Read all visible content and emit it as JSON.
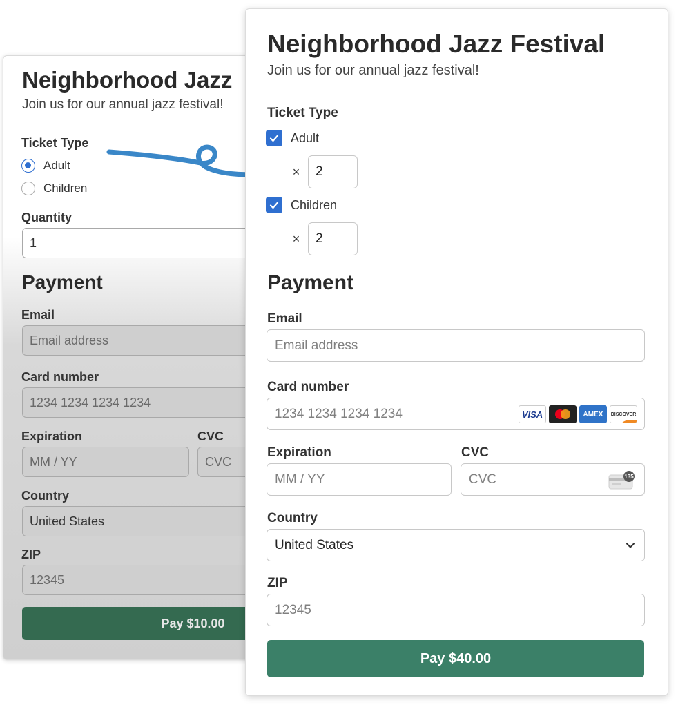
{
  "old_form": {
    "title": "Neighborhood Jazz",
    "subtitle": "Join us for our annual jazz festival!",
    "ticket_type_label": "Ticket Type",
    "ticket_options": [
      {
        "label": "Adult",
        "selected": true
      },
      {
        "label": "Children",
        "selected": false
      }
    ],
    "quantity_label": "Quantity",
    "quantity_value": "1",
    "payment_heading": "Payment",
    "email_label": "Email",
    "email_placeholder": "Email address",
    "card_label": "Card number",
    "card_placeholder": "1234 1234 1234 1234",
    "expiration_label": "Expiration",
    "expiration_placeholder": "MM / YY",
    "cvc_label": "CVC",
    "cvc_placeholder": "CVC",
    "country_label": "Country",
    "country_value": "United States",
    "zip_label": "ZIP",
    "zip_placeholder": "12345",
    "pay_label": "Pay $10.00"
  },
  "new_form": {
    "title": "Neighborhood Jazz Festival",
    "subtitle": "Join us for our annual jazz festival!",
    "ticket_type_label": "Ticket Type",
    "tickets": [
      {
        "label": "Adult",
        "checked": true,
        "times": "×",
        "quantity": "2"
      },
      {
        "label": "Children",
        "checked": true,
        "times": "×",
        "quantity": "2"
      }
    ],
    "payment_heading": "Payment",
    "email_label": "Email",
    "email_placeholder": "Email address",
    "card_label": "Card number",
    "card_placeholder": "1234 1234 1234 1234",
    "card_brands": [
      "VISA",
      "mastercard",
      "AMEX",
      "DISCOVER"
    ],
    "expiration_label": "Expiration",
    "expiration_placeholder": "MM / YY",
    "cvc_label": "CVC",
    "cvc_placeholder": "CVC",
    "cvc_icon_text": "135",
    "country_label": "Country",
    "country_value": "United States",
    "zip_label": "ZIP",
    "zip_placeholder": "12345",
    "pay_label": "Pay $40.00"
  },
  "colors": {
    "accent_blue": "#2f6fd0",
    "pay_green": "#3b8068",
    "old_pay_green": "#346a50",
    "arrow_blue": "#3a87c8"
  },
  "icons": [
    "check-icon",
    "chevron-down-icon",
    "cvc-card-icon",
    "curly-arrow-icon"
  ]
}
